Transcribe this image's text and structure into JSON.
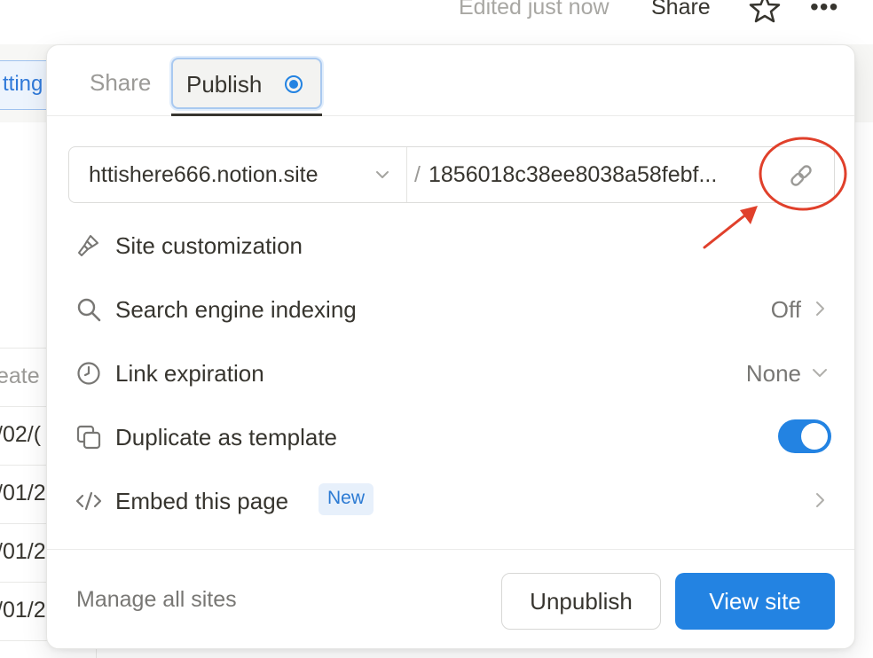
{
  "topbar": {
    "edited_text": "Edited just now",
    "share_label": "Share",
    "star_icon": "star-icon",
    "more_icon": "more-icon"
  },
  "background": {
    "settings_chip": "tting",
    "column_header": "eate",
    "cells": [
      "/02/(",
      "/01/2",
      "/01/2",
      "/01/2"
    ]
  },
  "popup": {
    "tabs": {
      "share": "Share",
      "publish": "Publish"
    },
    "url": {
      "domain": "httishere666.notion.site",
      "slash": "/",
      "slug": "1856018c38ee8038a58febf..."
    },
    "rows": {
      "site_customization": {
        "label": "Site customization",
        "icon": "brush-icon"
      },
      "search_indexing": {
        "label": "Search engine indexing",
        "value": "Off",
        "icon": "search-icon"
      },
      "link_expiration": {
        "label": "Link expiration",
        "value": "None",
        "icon": "clock-icon"
      },
      "duplicate_template": {
        "label": "Duplicate as template",
        "icon": "duplicate-icon",
        "enabled": true
      },
      "embed": {
        "label": "Embed this page",
        "badge": "New",
        "icon": "code-icon"
      }
    },
    "footer": {
      "manage": "Manage all sites",
      "unpublish": "Unpublish",
      "view_site": "View site"
    }
  },
  "colors": {
    "accent": "#2383e2",
    "annotation": "#e0402b"
  }
}
